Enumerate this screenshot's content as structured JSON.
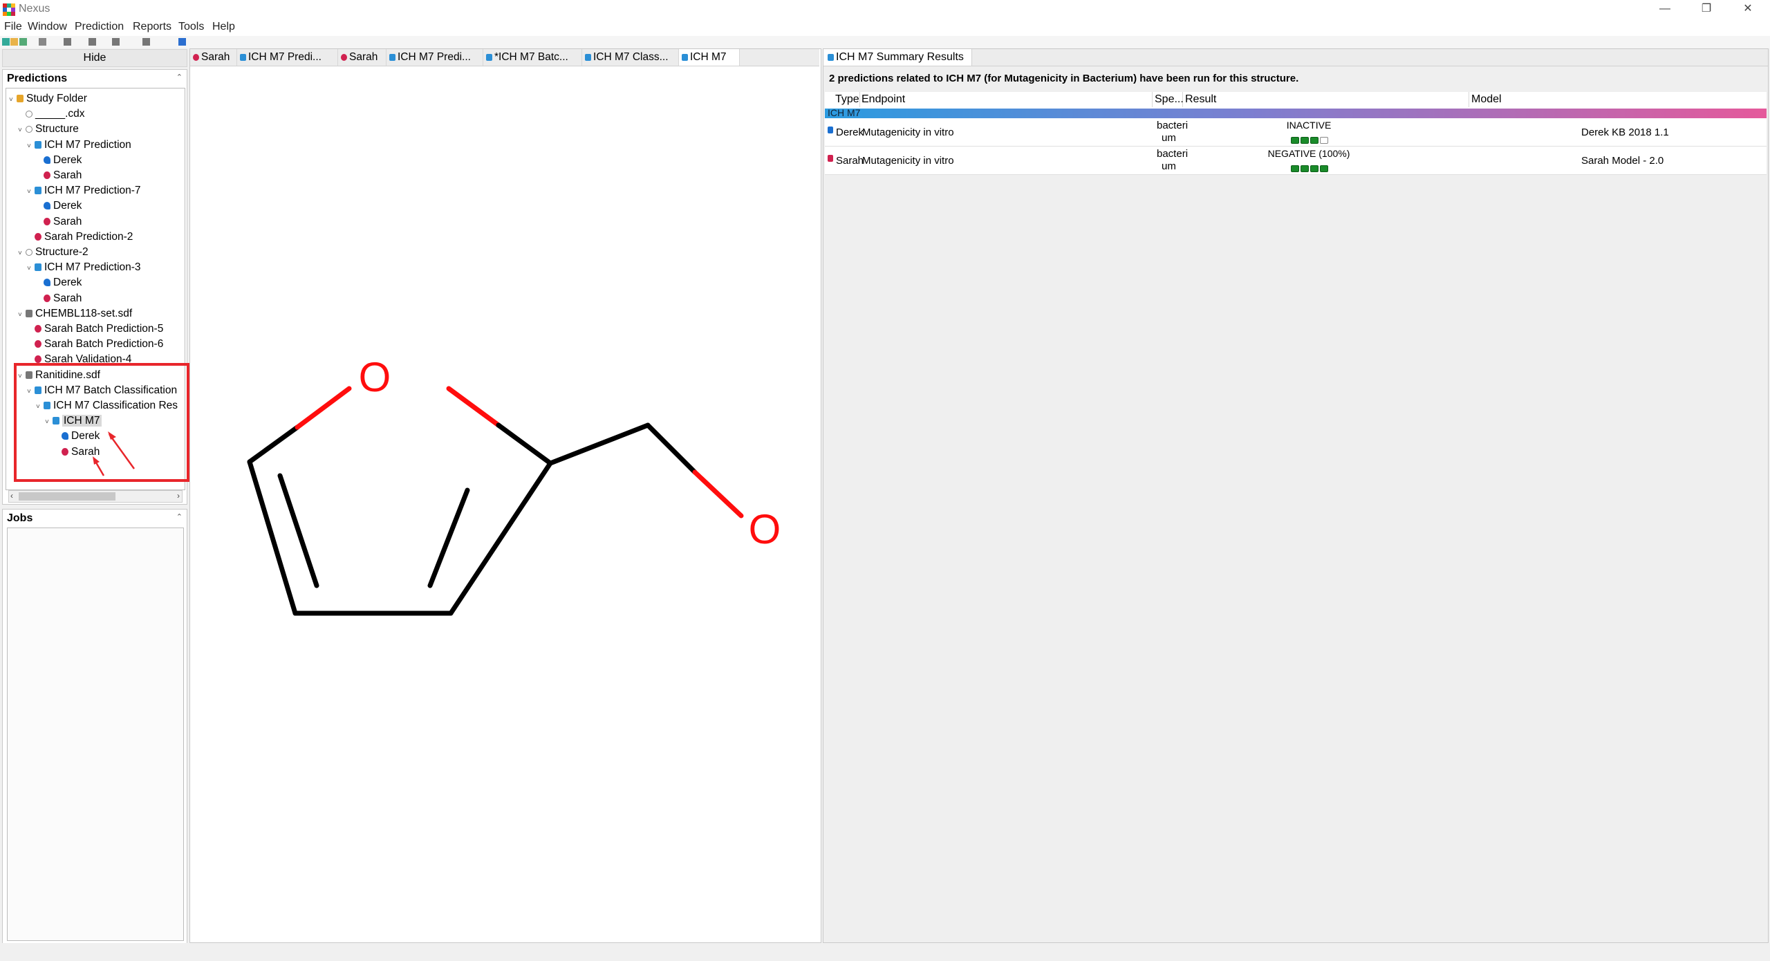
{
  "window": {
    "title": "Nexus",
    "controls": [
      "—",
      "❐",
      "✕"
    ]
  },
  "menu": [
    "File",
    "Window",
    "Prediction",
    "Reports",
    "Tools",
    "Help"
  ],
  "left": {
    "hide_label": "Hide",
    "predictions_title": "Predictions",
    "tree": [
      {
        "label": "Study Folder",
        "icon": "folder-icon",
        "kind": "folder",
        "indent": 0,
        "twisty": "˅"
      },
      {
        "label": "_____.cdx",
        "icon": "cdx-icon",
        "kind": "cdx",
        "indent": 1,
        "twisty": ""
      },
      {
        "label": "Structure",
        "icon": "structure-icon",
        "kind": "struct",
        "indent": 1,
        "twisty": "˅"
      },
      {
        "label": "ICH M7 Prediction",
        "icon": "ich-icon",
        "kind": "ich",
        "indent": 2,
        "twisty": "˅"
      },
      {
        "label": "Derek",
        "icon": "derek-icon",
        "kind": "derek",
        "indent": 3,
        "twisty": ""
      },
      {
        "label": "Sarah",
        "icon": "sarah-icon",
        "kind": "sarah",
        "indent": 3,
        "twisty": ""
      },
      {
        "label": "ICH M7 Prediction-7",
        "icon": "ich-icon",
        "kind": "ich",
        "indent": 2,
        "twisty": "˅"
      },
      {
        "label": "Derek",
        "icon": "derek-icon",
        "kind": "derek",
        "indent": 3,
        "twisty": ""
      },
      {
        "label": "Sarah",
        "icon": "sarah-icon",
        "kind": "sarah",
        "indent": 3,
        "twisty": ""
      },
      {
        "label": "Sarah Prediction-2",
        "icon": "sarah-icon",
        "kind": "sarah",
        "indent": 2,
        "twisty": ""
      },
      {
        "label": "Structure-2",
        "icon": "structure-icon",
        "kind": "struct",
        "indent": 1,
        "twisty": "˅"
      },
      {
        "label": "ICH M7 Prediction-3",
        "icon": "ich-icon",
        "kind": "ich",
        "indent": 2,
        "twisty": "˅"
      },
      {
        "label": "Derek",
        "icon": "derek-icon",
        "kind": "derek",
        "indent": 3,
        "twisty": ""
      },
      {
        "label": "Sarah",
        "icon": "sarah-icon",
        "kind": "sarah",
        "indent": 3,
        "twisty": ""
      },
      {
        "label": "CHEMBL118-set.sdf",
        "icon": "sdf-icon",
        "kind": "sdf",
        "indent": 1,
        "twisty": "˅"
      },
      {
        "label": "Sarah Batch Prediction-5",
        "icon": "sarah-icon",
        "kind": "sarah",
        "indent": 2,
        "twisty": ""
      },
      {
        "label": "Sarah Batch Prediction-6",
        "icon": "sarah-icon",
        "kind": "sarah",
        "indent": 2,
        "twisty": ""
      },
      {
        "label": "Sarah Validation-4",
        "icon": "sarah-icon",
        "kind": "sarah",
        "indent": 2,
        "twisty": ""
      },
      {
        "label": "Ranitidine.sdf",
        "icon": "sdf-icon",
        "kind": "sdf",
        "indent": 1,
        "twisty": "˅"
      },
      {
        "label": "ICH M7 Batch Classification",
        "icon": "ich-icon",
        "kind": "ich",
        "indent": 2,
        "twisty": "˅"
      },
      {
        "label": "ICH M7 Classification Res",
        "icon": "ich-icon",
        "kind": "ich",
        "indent": 3,
        "twisty": "˅"
      },
      {
        "label": "ICH M7",
        "icon": "ich-icon",
        "kind": "ich",
        "indent": 4,
        "twisty": "˅",
        "selected": true
      },
      {
        "label": "Derek",
        "icon": "derek-icon",
        "kind": "derek",
        "indent": 5,
        "twisty": ""
      },
      {
        "label": "Sarah",
        "icon": "sarah-icon",
        "kind": "sarah",
        "indent": 5,
        "twisty": ""
      }
    ],
    "jobs_title": "Jobs"
  },
  "editor": {
    "tabs": [
      {
        "label": "Sarah",
        "kind": "sarah"
      },
      {
        "label": "ICH M7 Predi...",
        "kind": "ich"
      },
      {
        "label": "Sarah",
        "kind": "sarah"
      },
      {
        "label": "ICH M7 Predi...",
        "kind": "ich"
      },
      {
        "label": "*ICH M7 Batc...",
        "kind": "ich"
      },
      {
        "label": "ICH M7 Class...",
        "kind": "ich"
      },
      {
        "label": "ICH M7",
        "kind": "ich",
        "active": true
      }
    ],
    "atom_labels": {
      "o1": "O",
      "o2": "O"
    }
  },
  "results": {
    "tab_label": "ICH M7 Summary Results",
    "summary": "2 predictions related to ICH M7 (for Mutagenicity in Bacterium) have been run for this structure.",
    "columns": {
      "type": "Type",
      "endpoint": "Endpoint",
      "species": "Spe...",
      "result": "Result",
      "model": "Model"
    },
    "group_label": "ICH M7",
    "rows": [
      {
        "type": "Derek",
        "endpoint": "Mutagenicity in vitro",
        "species_1": "bacteri",
        "species_2": "um",
        "result": "INACTIVE",
        "conf_filled": 3,
        "conf_total": 4,
        "model": "Derek KB 2018 1.1"
      },
      {
        "type": "Sarah",
        "endpoint": "Mutagenicity in vitro",
        "species_1": "bacteri",
        "species_2": "um",
        "result": "NEGATIVE (100%)",
        "conf_filled": 4,
        "conf_total": 4,
        "model": "Sarah Model - 2.0"
      }
    ]
  },
  "colors": {
    "highlight": "#e8262b",
    "oxygen": "#ff0d0d",
    "bond": "#000000",
    "derek": "#1a6fd1",
    "sarah": "#d0214f",
    "ich": "#2b8fd6"
  }
}
